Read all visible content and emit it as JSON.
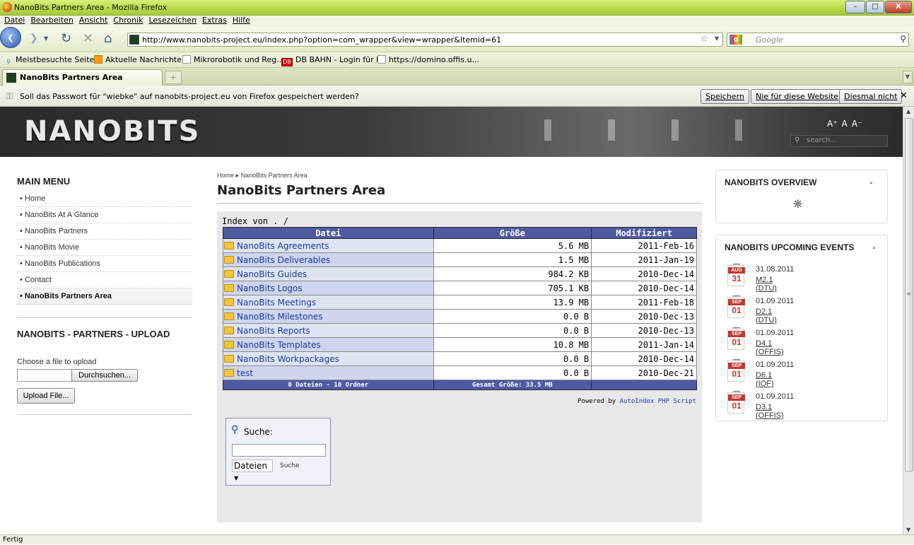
{
  "window": {
    "title": "NanoBits Partners Area - Mozilla Firefox"
  },
  "menu": [
    "Datei",
    "Bearbeiten",
    "Ansicht",
    "Chronik",
    "Lesezeichen",
    "Extras",
    "Hilfe"
  ],
  "navbar": {
    "url": "http://www.nanobits-project.eu/index.php?option=com_wrapper&view=wrapper&Itemid=61",
    "search_placeholder": "Google"
  },
  "bookmarks": [
    "Meistbesuchte Seiten",
    "Aktuelle Nachrichten",
    "Mikrorobotik und Reg...",
    "DB BAHN - Login für F...",
    "https://domino.offis.u..."
  ],
  "tab": {
    "title": "NanoBits Partners Area"
  },
  "password_bar": {
    "message": "Soll das Passwort für \"wiebke\" auf nanobits-project.eu von Firefox gespeichert werden?",
    "save": "Speichern",
    "never": "Nie für diese Website",
    "not_now": "Diesmal nicht"
  },
  "site": {
    "logo": "NANOBITS",
    "font_size_controls": [
      "A⁺",
      "A",
      "A⁻"
    ],
    "search_placeholder": "search..."
  },
  "main_menu": {
    "title": "MAIN MENU",
    "items": [
      "Home",
      "NanoBits At A Glance",
      "NanoBits Partners",
      "NanoBits Movie",
      "NanoBits Publications",
      "Contact",
      "NanoBits Partners Area"
    ]
  },
  "upload": {
    "title": "NANOBITS - PARTNERS - UPLOAD",
    "label": "Choose a file to upload",
    "browse": "Durchsuchen...",
    "submit": "Upload File..."
  },
  "breadcrumb": {
    "home": "Home",
    "current": "NanoBits Partners Area"
  },
  "page_title": "NanoBits Partners Area",
  "index": {
    "label": "Index von . /",
    "headers": [
      "Datei",
      "Größe",
      "Modifiziert"
    ],
    "rows": [
      {
        "name": "NanoBits Agreements",
        "size": "5.6 MB",
        "modified": "2011-Feb-16"
      },
      {
        "name": "NanoBits Deliverables",
        "size": "1.5 MB",
        "modified": "2011-Jan-19"
      },
      {
        "name": "NanoBits Guides",
        "size": "984.2 KB",
        "modified": "2010-Dec-14"
      },
      {
        "name": "NanoBits Logos",
        "size": "705.1 KB",
        "modified": "2010-Dec-14"
      },
      {
        "name": "NanoBits Meetings",
        "size": "13.9 MB",
        "modified": "2011-Feb-18"
      },
      {
        "name": "NanoBits Milestones",
        "size": "0.0  B",
        "modified": "2010-Dec-13"
      },
      {
        "name": "NanoBits Reports",
        "size": "0.0  B",
        "modified": "2010-Dec-13"
      },
      {
        "name": "NanoBits Templates",
        "size": "10.8 MB",
        "modified": "2011-Jan-14"
      },
      {
        "name": "NanoBits Workpackages",
        "size": "0.0  B",
        "modified": "2010-Dec-14"
      },
      {
        "name": "test",
        "size": "0.0  B",
        "modified": "2010-Dec-21"
      }
    ],
    "footer_count": "0 Dateien - 10 Ordner",
    "footer_total": "Gesamt Größe: 33.5 MB",
    "powered_prefix": "Powered by",
    "powered_link": "AutoIndex PHP Script"
  },
  "search": {
    "label": "Suche:",
    "select": "Dateien",
    "submit": "Suche"
  },
  "overview": {
    "title": "NANOBITS OVERVIEW"
  },
  "events": {
    "title": "NANOBITS UPCOMING EVENTS",
    "items": [
      {
        "month": "AUG",
        "day": "31",
        "date": "31.08.2011",
        "name": "M2.1 (DTU)"
      },
      {
        "month": "SEP",
        "day": "01",
        "date": "01.09.2011",
        "name": "D2.1 (DTU)"
      },
      {
        "month": "SEP",
        "day": "01",
        "date": "01.09.2011",
        "name": "D4.1 (OFFIS)"
      },
      {
        "month": "SEP",
        "day": "01",
        "date": "01.09.2011",
        "name": "D6.1 (IOF)"
      },
      {
        "month": "SEP",
        "day": "01",
        "date": "01.09.2011",
        "name": "D3.1 (OFFIS)"
      }
    ]
  },
  "status": "Fertig",
  "colors": {
    "table_header": "#4e5aa2",
    "accent_red": "#c0392b",
    "link_blue": "#1a3aa8"
  }
}
